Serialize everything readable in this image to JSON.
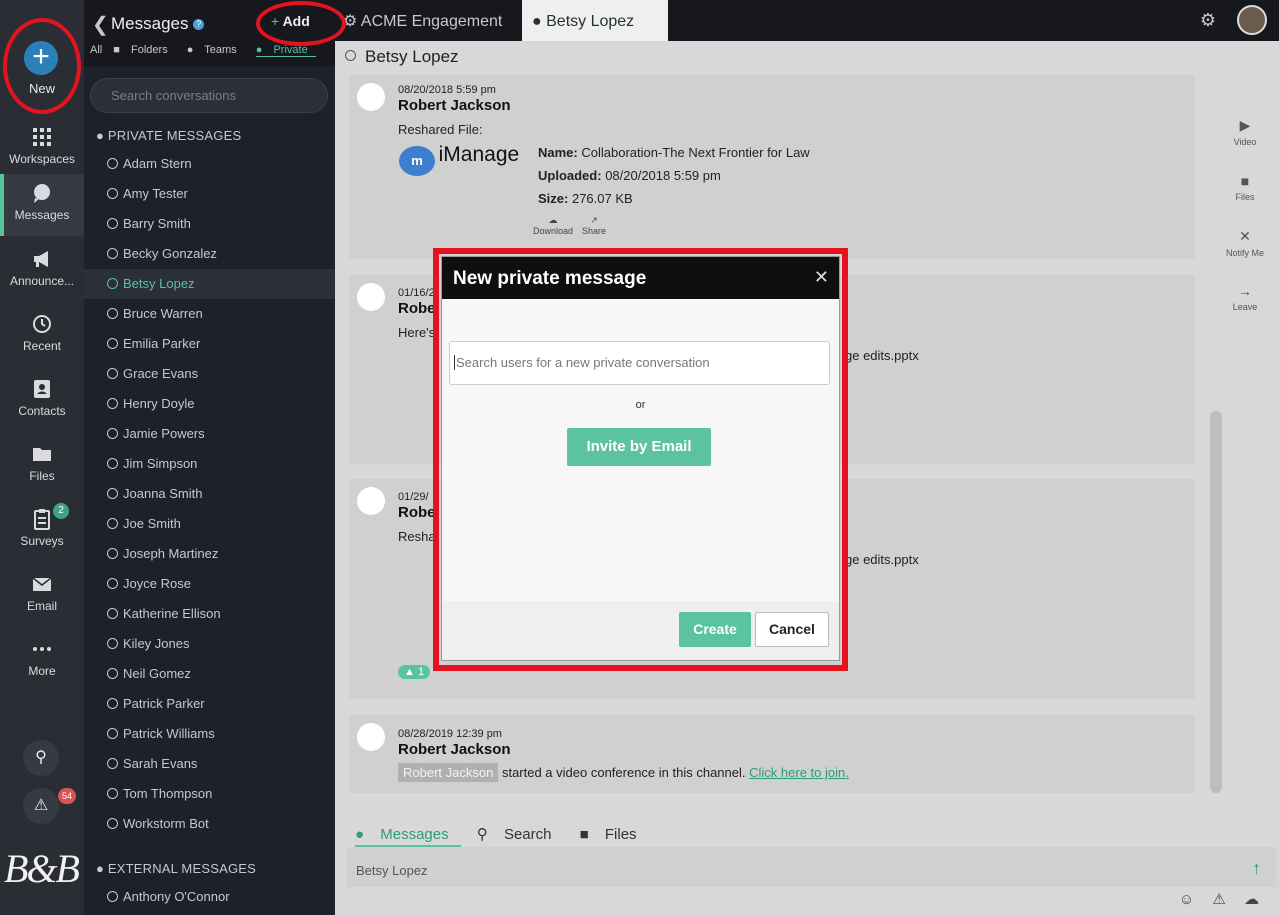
{
  "nav": {
    "new_label": "New",
    "items": [
      {
        "label": "Workspaces",
        "icon": "grid-icon"
      },
      {
        "label": "Messages",
        "icon": "chat-icon"
      },
      {
        "label": "Announce...",
        "icon": "megaphone-icon"
      },
      {
        "label": "Recent",
        "icon": "history-icon"
      },
      {
        "label": "Contacts",
        "icon": "contacts-icon"
      },
      {
        "label": "Files",
        "icon": "folder-icon"
      },
      {
        "label": "Surveys",
        "icon": "clipboard-icon"
      },
      {
        "label": "Email",
        "icon": "envelope-icon"
      },
      {
        "label": "More",
        "icon": "dots-icon"
      }
    ],
    "surveys_badge": "2",
    "alerts_badge": "54",
    "logo_text": "B&B"
  },
  "list": {
    "title": "Messages",
    "add_label": "Add",
    "filters": [
      "All",
      "Folders",
      "Teams",
      "Private"
    ],
    "search_placeholder": "Search conversations",
    "private_header": "PRIVATE MESSAGES",
    "external_header": "EXTERNAL MESSAGES",
    "private": [
      "Adam Stern",
      "Amy Tester",
      "Barry Smith",
      "Becky Gonzalez",
      "Betsy Lopez",
      "Bruce Warren",
      "Emilia Parker",
      "Grace Evans",
      "Henry Doyle",
      "Jamie Powers",
      "Jim Simpson",
      "Joanna Smith",
      "Joe Smith",
      "Joseph Martinez",
      "Joyce Rose",
      "Katherine Ellison",
      "Kiley Jones",
      "Neil Gomez",
      "Patrick Parker",
      "Patrick Williams",
      "Sarah Evans",
      "Tom Thompson",
      "Workstorm Bot"
    ],
    "external": [
      "Anthony O'Connor"
    ]
  },
  "tabs": {
    "workspace": "ACME Engagement",
    "conversation": "Betsy Lopez"
  },
  "main": {
    "title": "Betsy Lopez",
    "messages": [
      {
        "date": "08/20/2018 5:59 pm",
        "author": "Robert Jackson",
        "reshared": "Reshared File:",
        "brand": "iManage",
        "name_label": "Name:",
        "name_value": "Collaboration-The Next Frontier for Law",
        "uploaded_label": "Uploaded:",
        "uploaded_value": "08/20/2018 5:59 pm",
        "size_label": "Size:",
        "size_value": "276.07 KB",
        "download": "Download",
        "share": "Share"
      },
      {
        "date": "01/16/2",
        "author": "Robe",
        "text": "Here's",
        "file_fragment": "ge edits.pptx"
      },
      {
        "date": "01/29/",
        "author": "Robe",
        "text": "Resha",
        "file_fragment": "ge edits.pptx",
        "reaction_count": "1"
      },
      {
        "date": "08/28/2019 12:39 pm",
        "author": "Robert Jackson",
        "chip": "Robert Jackson",
        "text": "started a video conference in this channel.",
        "link": "Click here to join."
      }
    ],
    "actions": [
      "Video",
      "Files",
      "Notify Me",
      "Leave"
    ],
    "bottom_tabs": [
      "Messages",
      "Search",
      "Files"
    ],
    "composer_placeholder": "Betsy Lopez"
  },
  "modal": {
    "title": "New private message",
    "input_placeholder": "Search users for a new private conversation",
    "or": "or",
    "invite_label": "Invite by Email",
    "create_label": "Create",
    "cancel_label": "Cancel"
  },
  "colors": {
    "accent": "#57c49d",
    "annotation": "#e3141f",
    "sidebar": "#2a2d34"
  }
}
